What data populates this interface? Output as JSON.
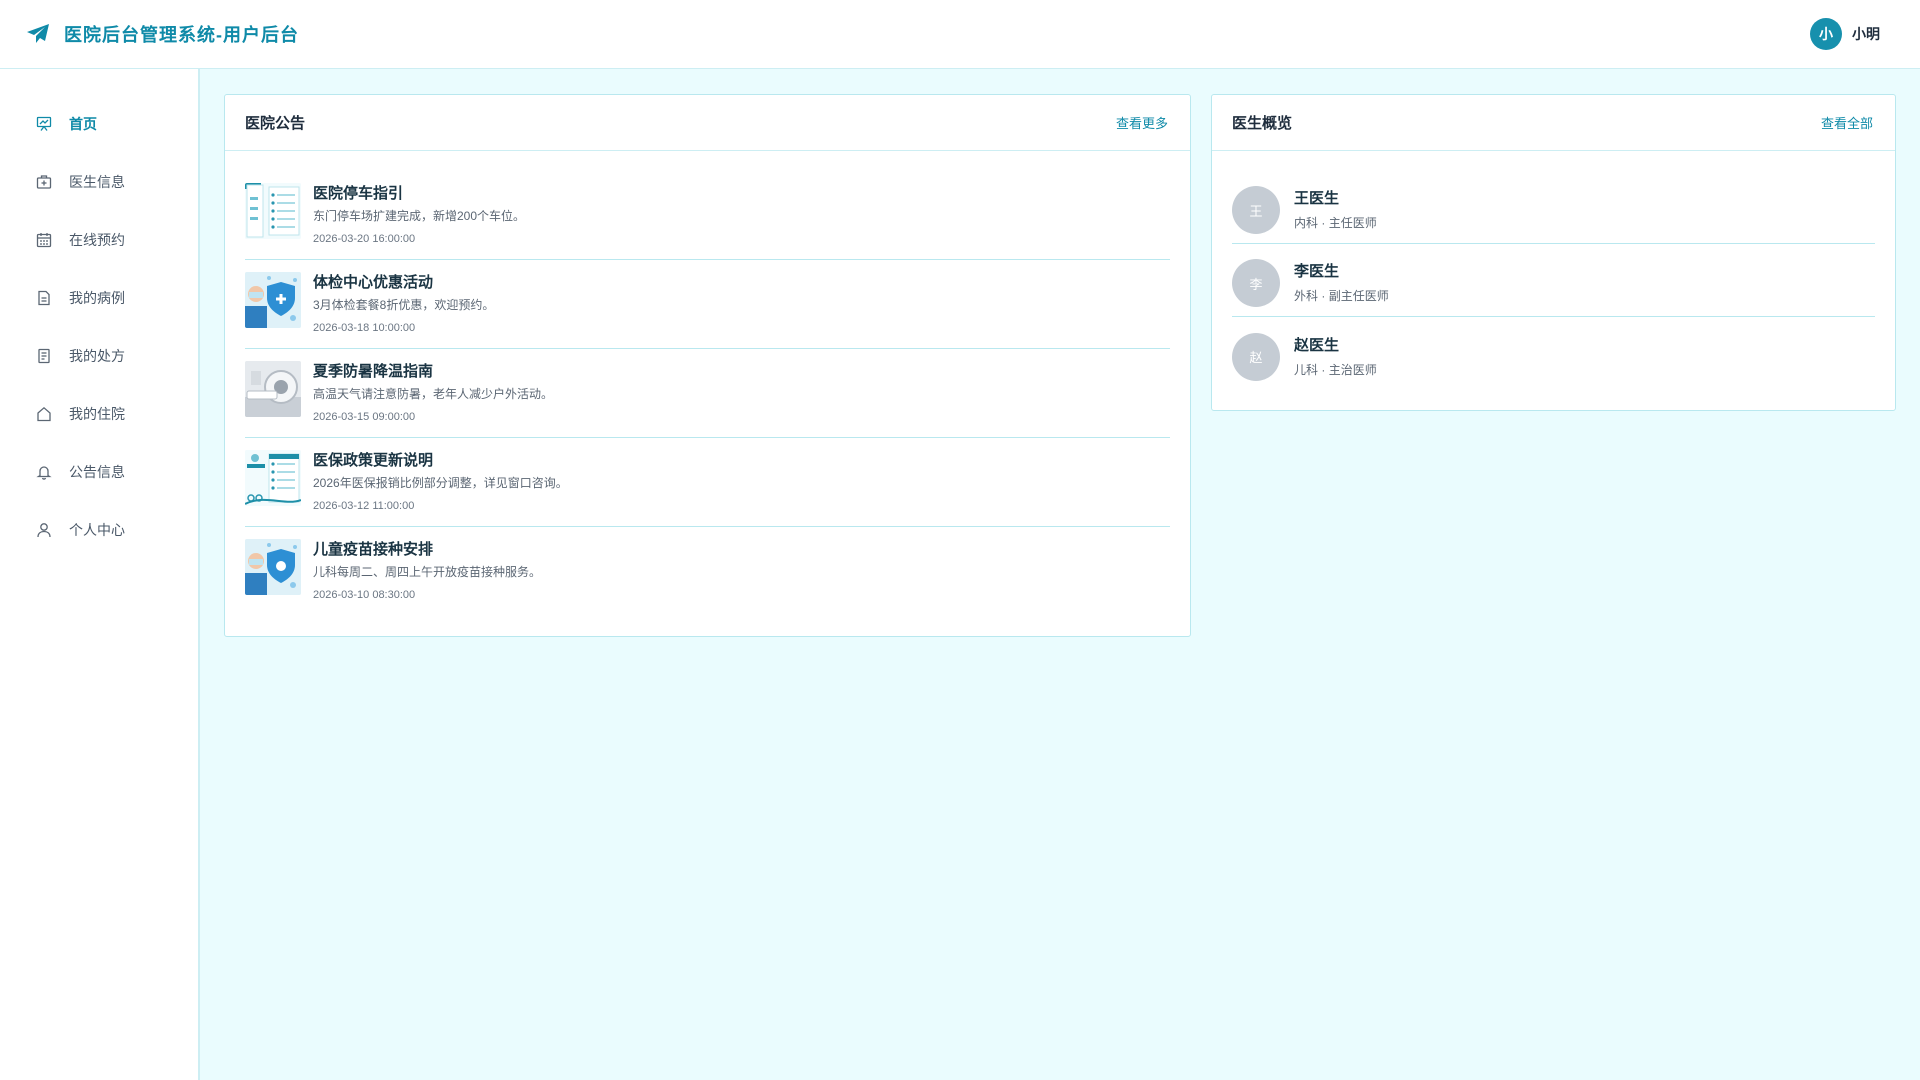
{
  "header": {
    "title": "医院后台管理系统-用户后台",
    "logo_icon": "paper-plane-icon",
    "user": {
      "avatar_text": "小",
      "name": "小明"
    }
  },
  "sidebar": {
    "items": [
      {
        "label": "首页",
        "icon": "chart-board-icon",
        "active": true
      },
      {
        "label": "医生信息",
        "icon": "medical-kit-icon",
        "active": false
      },
      {
        "label": "在线预约",
        "icon": "calendar-icon",
        "active": false
      },
      {
        "label": "我的病例",
        "icon": "document-icon",
        "active": false
      },
      {
        "label": "我的处方",
        "icon": "prescription-icon",
        "active": false
      },
      {
        "label": "我的住院",
        "icon": "home-icon",
        "active": false
      },
      {
        "label": "公告信息",
        "icon": "bell-icon",
        "active": false
      },
      {
        "label": "个人中心",
        "icon": "user-icon",
        "active": false
      }
    ]
  },
  "notices": {
    "title": "医院公告",
    "more_label": "查看更多",
    "items": [
      {
        "title": "医院停车指引",
        "desc": "东门停车场扩建完成，新增200个车位。",
        "date": "2026-03-20 16:00:00",
        "thumb": "form"
      },
      {
        "title": "体检中心优惠活动",
        "desc": "3月体检套餐8折优惠，欢迎预约。",
        "date": "2026-03-18 10:00:00",
        "thumb": "doctor"
      },
      {
        "title": "夏季防暑降温指南",
        "desc": "高温天气请注意防暑，老年人减少户外活动。",
        "date": "2026-03-15 09:00:00",
        "thumb": "scanner"
      },
      {
        "title": "医保政策更新说明",
        "desc": "2026年医保报销比例部分调整，详见窗口咨询。",
        "date": "2026-03-12 11:00:00",
        "thumb": "form"
      },
      {
        "title": "儿童疫苗接种安排",
        "desc": "儿科每周二、周四上午开放疫苗接种服务。",
        "date": "2026-03-10 08:30:00",
        "thumb": "doctor"
      }
    ]
  },
  "doctors": {
    "title": "医生概览",
    "all_label": "查看全部",
    "items": [
      {
        "avatar": "王",
        "name": "王医生",
        "dept": "内科",
        "title": "主任医师"
      },
      {
        "avatar": "李",
        "name": "李医生",
        "dept": "外科",
        "title": "副主任医师"
      },
      {
        "avatar": "赵",
        "name": "赵医生",
        "dept": "儿科",
        "title": "主治医师"
      }
    ],
    "separator": " · "
  },
  "colors": {
    "accent": "#0f8aa8",
    "background": "#eafcfe",
    "border": "#b9e8ef"
  }
}
